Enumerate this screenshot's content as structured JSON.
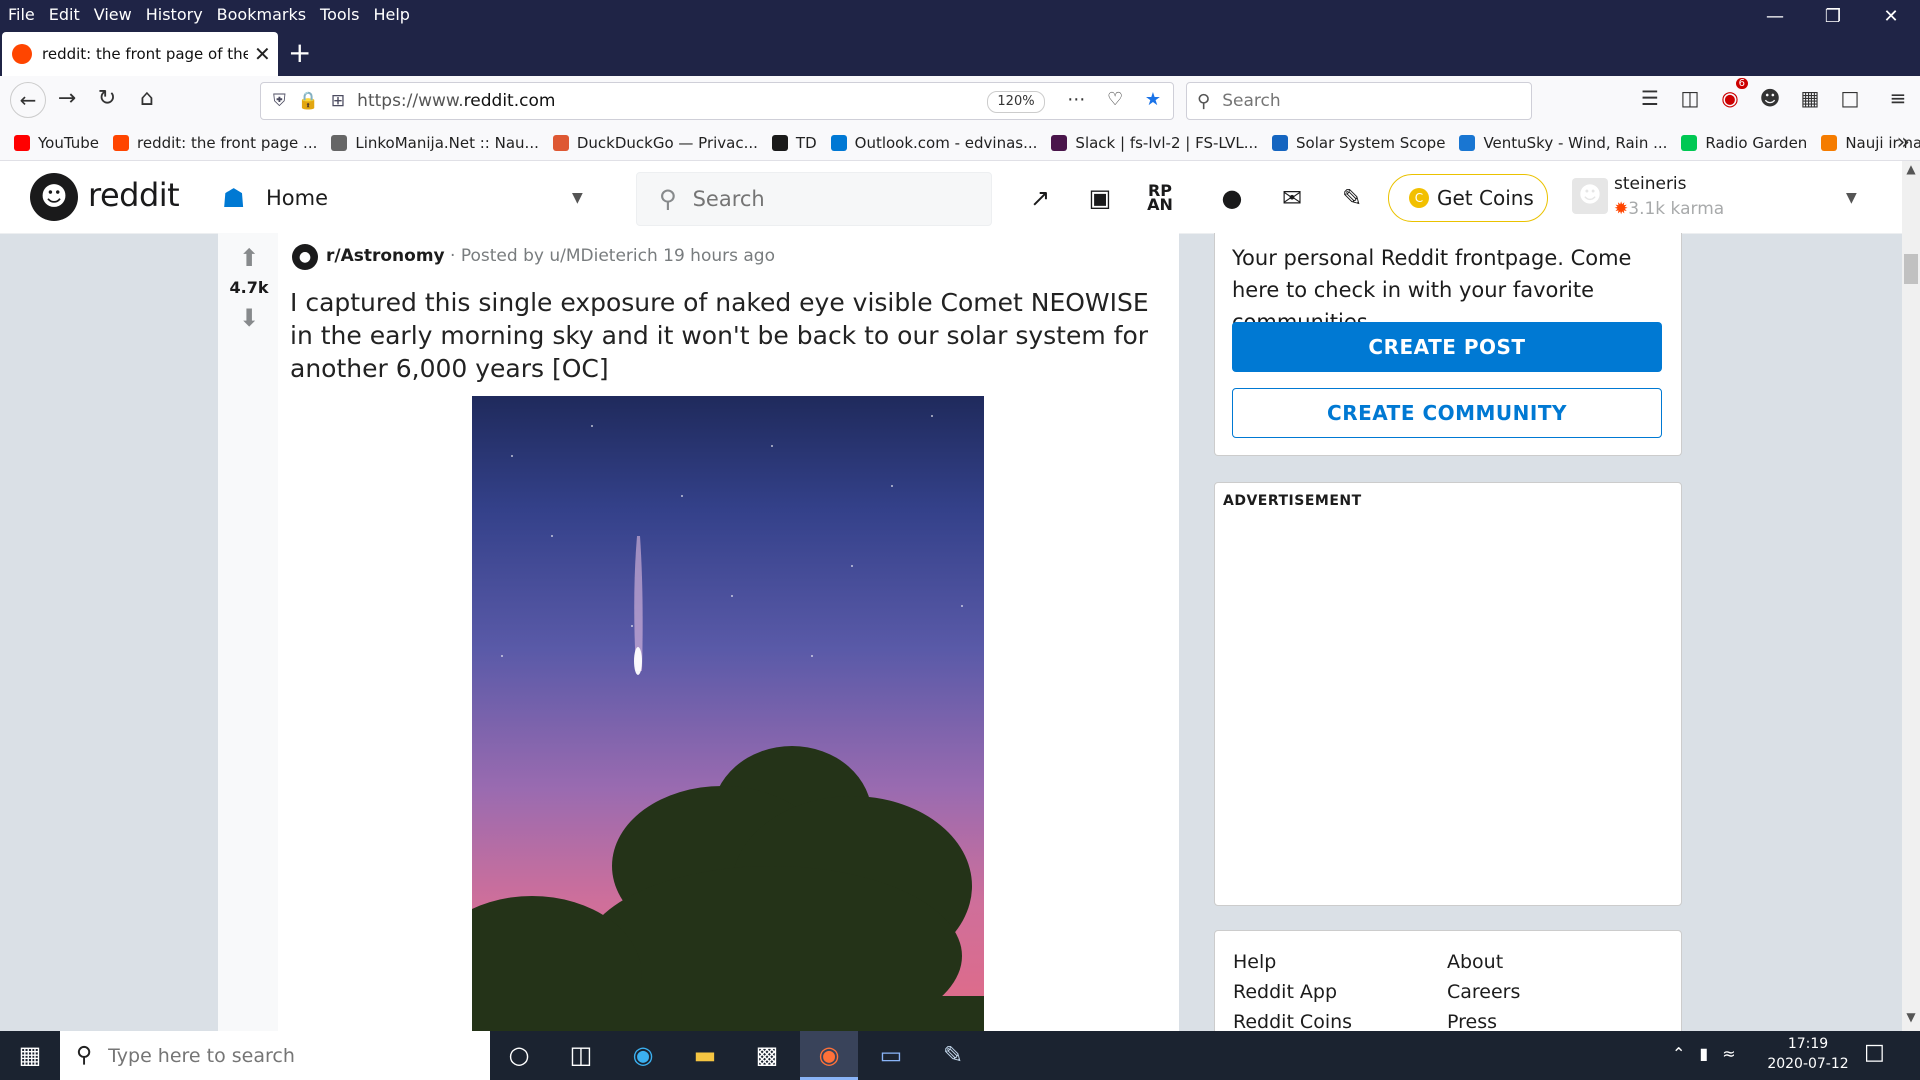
{
  "menubar": [
    "File",
    "Edit",
    "View",
    "History",
    "Bookmarks",
    "Tools",
    "Help"
  ],
  "tab": {
    "title": "reddit: the front page of the internet"
  },
  "urlbar": {
    "prefix": "https://www.",
    "domain": "reddit.com",
    "zoom": "120%"
  },
  "fx_search": {
    "placeholder": "Search"
  },
  "toolbar_badge": "6",
  "bookmarks": [
    {
      "label": "YouTube",
      "color": "#ff0000"
    },
    {
      "label": "reddit: the front page ...",
      "color": "#ff4500"
    },
    {
      "label": "LinkoManija.Net :: Nau...",
      "color": "#666666"
    },
    {
      "label": "DuckDuckGo — Privac...",
      "color": "#de5833"
    },
    {
      "label": "TD",
      "color": "#1a1a1a"
    },
    {
      "label": "Outlook.com - edvinas...",
      "color": "#0078d4"
    },
    {
      "label": "Slack | fs-lvl-2 | FS-LVL...",
      "color": "#4a154b"
    },
    {
      "label": "Solar System Scope",
      "color": "#1565c0"
    },
    {
      "label": "VentuSky - Wind, Rain ...",
      "color": "#1976d2"
    },
    {
      "label": "Radio Garden",
      "color": "#00c853"
    },
    {
      "label": "Nauji ir naudoti auto...",
      "color": "#f57c00"
    }
  ],
  "reddit": {
    "wordmark": "reddit",
    "home_label": "Home",
    "search_placeholder": "Search",
    "get_coins": "Get Coins",
    "username": "steineris",
    "karma": "3.1k karma"
  },
  "post": {
    "score": "4.7k",
    "subreddit": "r/Astronomy",
    "meta": " · Posted by u/MDieterich 19 hours ago",
    "title": "I captured this single exposure of naked eye visible Comet NEOWISE in the early morning sky and it won't be back to our solar system for another 6,000 years [OC]"
  },
  "sidebar": {
    "intro": "Your personal Reddit frontpage. Come here to check in with your favorite communities.",
    "create_post": "CREATE POST",
    "create_community": "CREATE COMMUNITY",
    "ad_label": "ADVERTISEMENT",
    "links_col1": [
      "Help",
      "Reddit App",
      "Reddit Coins"
    ],
    "links_col2": [
      "About",
      "Careers",
      "Press"
    ]
  },
  "taskbar": {
    "search_placeholder": "Type here to search",
    "time": "17:19",
    "date": "2020-07-12"
  }
}
